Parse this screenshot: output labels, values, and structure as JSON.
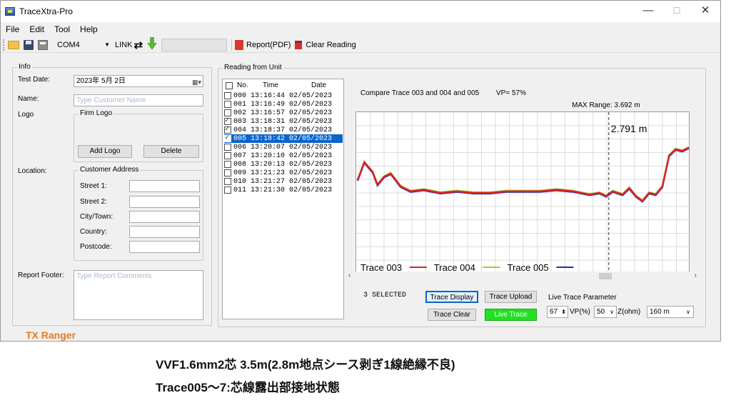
{
  "window": {
    "title": "TraceXtra-Pro",
    "minimize": "—",
    "maximize": "☐",
    "close": "✕"
  },
  "menu": [
    "File",
    "Edit",
    "Tool",
    "Help"
  ],
  "toolbar": {
    "port": "COM4",
    "link_label": "LINK",
    "link_icon": "⇄",
    "report_label": "Report(PDF)",
    "clear_label": "Clear Reading"
  },
  "info": {
    "group_title": "Info",
    "test_date_label": "Test Date:",
    "test_date_value": "2023年  5月  2日",
    "name_label": "Name:",
    "name_placeholder": "Type Customer Name",
    "logo_label": "Logo",
    "firm_logo_title": "Firm Logo",
    "add_logo": "Add Logo",
    "delete": "Delete",
    "location_label": "Location:",
    "address_title": "Customer Address",
    "street1": "Street 1:",
    "street2": "Street 2:",
    "city": "City/Town:",
    "country": "Country:",
    "postcode": "Postcode:",
    "footer_label": "Report Footer:",
    "footer_placeholder": "Type Report Comments",
    "brand": "TX Ranger"
  },
  "readings": {
    "group_title": "Reading from Unit",
    "col_no": "No.",
    "col_time": "Time",
    "col_date": "Date",
    "rows": [
      {
        "text": "000 13:16:44 02/05/2023",
        "checked": false,
        "selected": false
      },
      {
        "text": "001 13:16:49 02/05/2023",
        "checked": false,
        "selected": false
      },
      {
        "text": "002 13:16:57 02/05/2023",
        "checked": false,
        "selected": false
      },
      {
        "text": "003 13:18:31 02/05/2023",
        "checked": true,
        "selected": false
      },
      {
        "text": "004 13:18:37 02/05/2023",
        "checked": true,
        "selected": false
      },
      {
        "text": "005 13:18:42 02/05/2023",
        "checked": true,
        "selected": true
      },
      {
        "text": "006 13:20:07 02/05/2023",
        "checked": false,
        "selected": false
      },
      {
        "text": "007 13:20:10 02/05/2023",
        "checked": false,
        "selected": false
      },
      {
        "text": "008 13:20:13 02/05/2023",
        "checked": false,
        "selected": false
      },
      {
        "text": "009 13:21:23 02/05/2023",
        "checked": false,
        "selected": false
      },
      {
        "text": "010 13:21:27 02/05/2023",
        "checked": false,
        "selected": false
      },
      {
        "text": "011 13:21:30 02/05/2023",
        "checked": false,
        "selected": false
      }
    ]
  },
  "chart": {
    "compare_text": "Compare Trace 003 and 004 and 005",
    "vp_text": "VP= 57%",
    "max_range_text": "MAX Range: 3.692 m",
    "cursor_label": "2.791 m",
    "colors": {
      "t003": "#e02020",
      "t004": "#9ccc3a",
      "t005": "#2030c0"
    }
  },
  "chart_data": {
    "type": "line",
    "series": [
      {
        "name": "Trace 003"
      },
      {
        "name": "Trace 004"
      },
      {
        "name": "Trace 005"
      }
    ],
    "cursor_x": 2.791,
    "xlim": [
      0,
      3.692
    ]
  },
  "controls": {
    "selected_count": "3 SELECTED",
    "trace_display": "Trace Display",
    "trace_upload": "Trace Upload",
    "trace_clear": "Trace Clear",
    "live_trace": "Live Trace",
    "live_param_title": "Live Trace Parameter",
    "vp_value": "67",
    "vp_unit": "VP(%)",
    "z_value": "50",
    "z_unit": "Z(ohm)",
    "range_value": "160 m"
  },
  "caption": {
    "line1": "VVF1.6mm2芯  3.5m(2.8m地点シース剥ぎ1線絶縁不良)",
    "line2": "Trace005～7:芯線露出部接地状態"
  }
}
